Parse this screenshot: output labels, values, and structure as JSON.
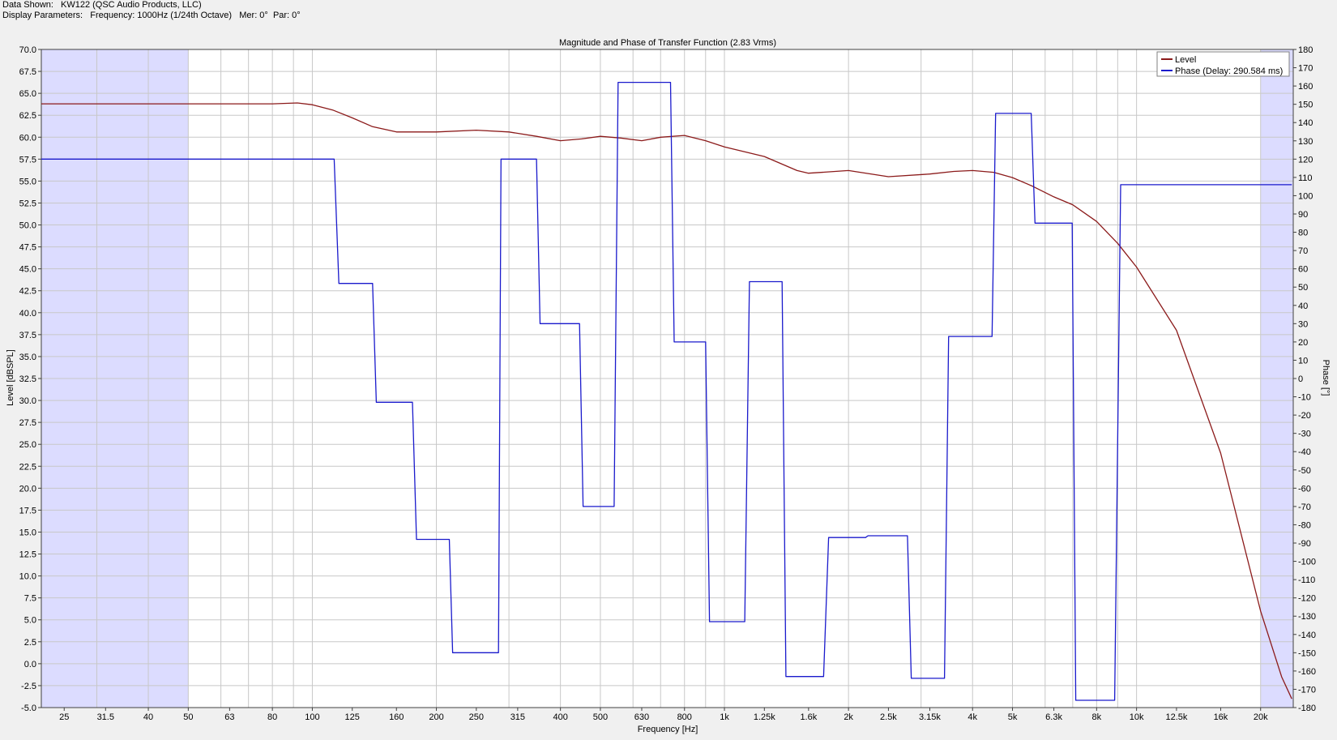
{
  "header": {
    "data_shown_label": "Data Shown:",
    "data_shown_value": "KW122 (QSC Audio Products, LLC)",
    "display_params_label": "Display Parameters:",
    "display_params_value": "Frequency: 1000Hz (1/24th Octave)   Mer: 0°  Par: 0°"
  },
  "colors": {
    "level": "#8b1a1a",
    "phase": "#1a1acc",
    "shade": "#dcdcff",
    "grid": "#c8c8c8"
  },
  "chart_data": {
    "type": "line",
    "title": "Magnitude and Phase of Transfer Function (2.83 Vrms)",
    "xlabel": "Frequency [Hz]",
    "ylabel": "Level [dBSPL]",
    "y2label": "Phase [°]",
    "xscale": "log",
    "xlim": [
      22,
      24000
    ],
    "ylim": [
      -5,
      70
    ],
    "y2lim": [
      -180,
      180
    ],
    "grid": true,
    "legend_position": "top-right",
    "shaded_bands": [
      [
        22,
        50
      ],
      [
        20000,
        24000
      ]
    ],
    "x_ticks": [
      {
        "v": 25,
        "label": "25"
      },
      {
        "v": 31.5,
        "label": "31.5"
      },
      {
        "v": 40,
        "label": "40"
      },
      {
        "v": 50,
        "label": "50"
      },
      {
        "v": 63,
        "label": "63"
      },
      {
        "v": 80,
        "label": "80"
      },
      {
        "v": 100,
        "label": "100"
      },
      {
        "v": 125,
        "label": "125"
      },
      {
        "v": 160,
        "label": "160"
      },
      {
        "v": 200,
        "label": "200"
      },
      {
        "v": 250,
        "label": "250"
      },
      {
        "v": 315,
        "label": "315"
      },
      {
        "v": 400,
        "label": "400"
      },
      {
        "v": 500,
        "label": "500"
      },
      {
        "v": 630,
        "label": "630"
      },
      {
        "v": 800,
        "label": "800"
      },
      {
        "v": 1000,
        "label": "1k"
      },
      {
        "v": 1250,
        "label": "1.25k"
      },
      {
        "v": 1600,
        "label": "1.6k"
      },
      {
        "v": 2000,
        "label": "2k"
      },
      {
        "v": 2500,
        "label": "2.5k"
      },
      {
        "v": 3150,
        "label": "3.15k"
      },
      {
        "v": 4000,
        "label": "4k"
      },
      {
        "v": 5000,
        "label": "5k"
      },
      {
        "v": 6300,
        "label": "6.3k"
      },
      {
        "v": 8000,
        "label": "8k"
      },
      {
        "v": 10000,
        "label": "10k"
      },
      {
        "v": 12500,
        "label": "12.5k"
      },
      {
        "v": 16000,
        "label": "16k"
      },
      {
        "v": 20000,
        "label": "20k"
      }
    ],
    "y_ticks": [
      "70.0",
      "67.5",
      "65.0",
      "62.5",
      "60.0",
      "57.5",
      "55.0",
      "52.5",
      "50.0",
      "47.5",
      "45.0",
      "42.5",
      "40.0",
      "37.5",
      "35.0",
      "32.5",
      "30.0",
      "27.5",
      "25.0",
      "22.5",
      "20.0",
      "17.5",
      "15.0",
      "12.5",
      "10.0",
      "7.5",
      "5.0",
      "2.5",
      "0.0",
      "-2.5",
      "-5.0"
    ],
    "y2_ticks": [
      "180",
      "170",
      "160",
      "150",
      "140",
      "130",
      "120",
      "110",
      "100",
      "90",
      "80",
      "70",
      "60",
      "50",
      "40",
      "30",
      "20",
      "10",
      "0",
      "-10",
      "-20",
      "-30",
      "-40",
      "-50",
      "-60",
      "-70",
      "-80",
      "-90",
      "-100",
      "-110",
      "-120",
      "-130",
      "-140",
      "-150",
      "-160",
      "-170",
      "-180"
    ],
    "series": [
      {
        "name": "Level",
        "axis": "left",
        "points": [
          [
            22,
            63.8
          ],
          [
            50,
            63.8
          ],
          [
            80,
            63.8
          ],
          [
            92,
            63.9
          ],
          [
            100,
            63.7
          ],
          [
            112,
            63.1
          ],
          [
            125,
            62.2
          ],
          [
            140,
            61.2
          ],
          [
            160,
            60.6
          ],
          [
            200,
            60.6
          ],
          [
            250,
            60.8
          ],
          [
            300,
            60.6
          ],
          [
            350,
            60.1
          ],
          [
            400,
            59.6
          ],
          [
            450,
            59.8
          ],
          [
            500,
            60.1
          ],
          [
            560,
            59.9
          ],
          [
            630,
            59.6
          ],
          [
            700,
            60.0
          ],
          [
            800,
            60.2
          ],
          [
            900,
            59.6
          ],
          [
            1000,
            58.9
          ],
          [
            1250,
            57.8
          ],
          [
            1500,
            56.2
          ],
          [
            1600,
            55.9
          ],
          [
            2000,
            56.2
          ],
          [
            2500,
            55.5
          ],
          [
            3150,
            55.8
          ],
          [
            3600,
            56.1
          ],
          [
            4000,
            56.2
          ],
          [
            4500,
            56.0
          ],
          [
            5000,
            55.4
          ],
          [
            5600,
            54.4
          ],
          [
            6300,
            53.2
          ],
          [
            7000,
            52.3
          ],
          [
            8000,
            50.4
          ],
          [
            9000,
            47.9
          ],
          [
            10000,
            45.2
          ],
          [
            12500,
            38.0
          ],
          [
            16000,
            24.0
          ],
          [
            20000,
            6.0
          ],
          [
            22500,
            -1.5
          ],
          [
            23800,
            -4.0
          ]
        ]
      },
      {
        "name": "Phase (Delay: 290.584 ms)",
        "axis": "right",
        "points": [
          [
            22,
            120
          ],
          [
            113,
            120
          ],
          [
            116,
            52
          ],
          [
            140,
            52
          ],
          [
            143,
            -13
          ],
          [
            175,
            -13
          ],
          [
            179,
            -88
          ],
          [
            215,
            -88
          ],
          [
            219,
            -150
          ],
          [
            283,
            -150
          ],
          [
            287,
            120
          ],
          [
            350,
            120
          ],
          [
            357,
            30
          ],
          [
            445,
            30
          ],
          [
            454,
            -70
          ],
          [
            540,
            -70
          ],
          [
            552,
            162
          ],
          [
            740,
            162
          ],
          [
            755,
            20
          ],
          [
            900,
            20
          ],
          [
            920,
            -133
          ],
          [
            1120,
            -133
          ],
          [
            1150,
            53
          ],
          [
            1380,
            53
          ],
          [
            1410,
            -163
          ],
          [
            1740,
            -163
          ],
          [
            1790,
            -87
          ],
          [
            2200,
            -87
          ],
          [
            2230,
            -86
          ],
          [
            2780,
            -86
          ],
          [
            2840,
            -164
          ],
          [
            3420,
            -164
          ],
          [
            3500,
            23
          ],
          [
            4460,
            23
          ],
          [
            4550,
            145
          ],
          [
            5550,
            145
          ],
          [
            5670,
            85
          ],
          [
            6980,
            85
          ],
          [
            7120,
            -176
          ],
          [
            8850,
            -176
          ],
          [
            9150,
            106
          ],
          [
            23800,
            106
          ]
        ]
      }
    ]
  }
}
